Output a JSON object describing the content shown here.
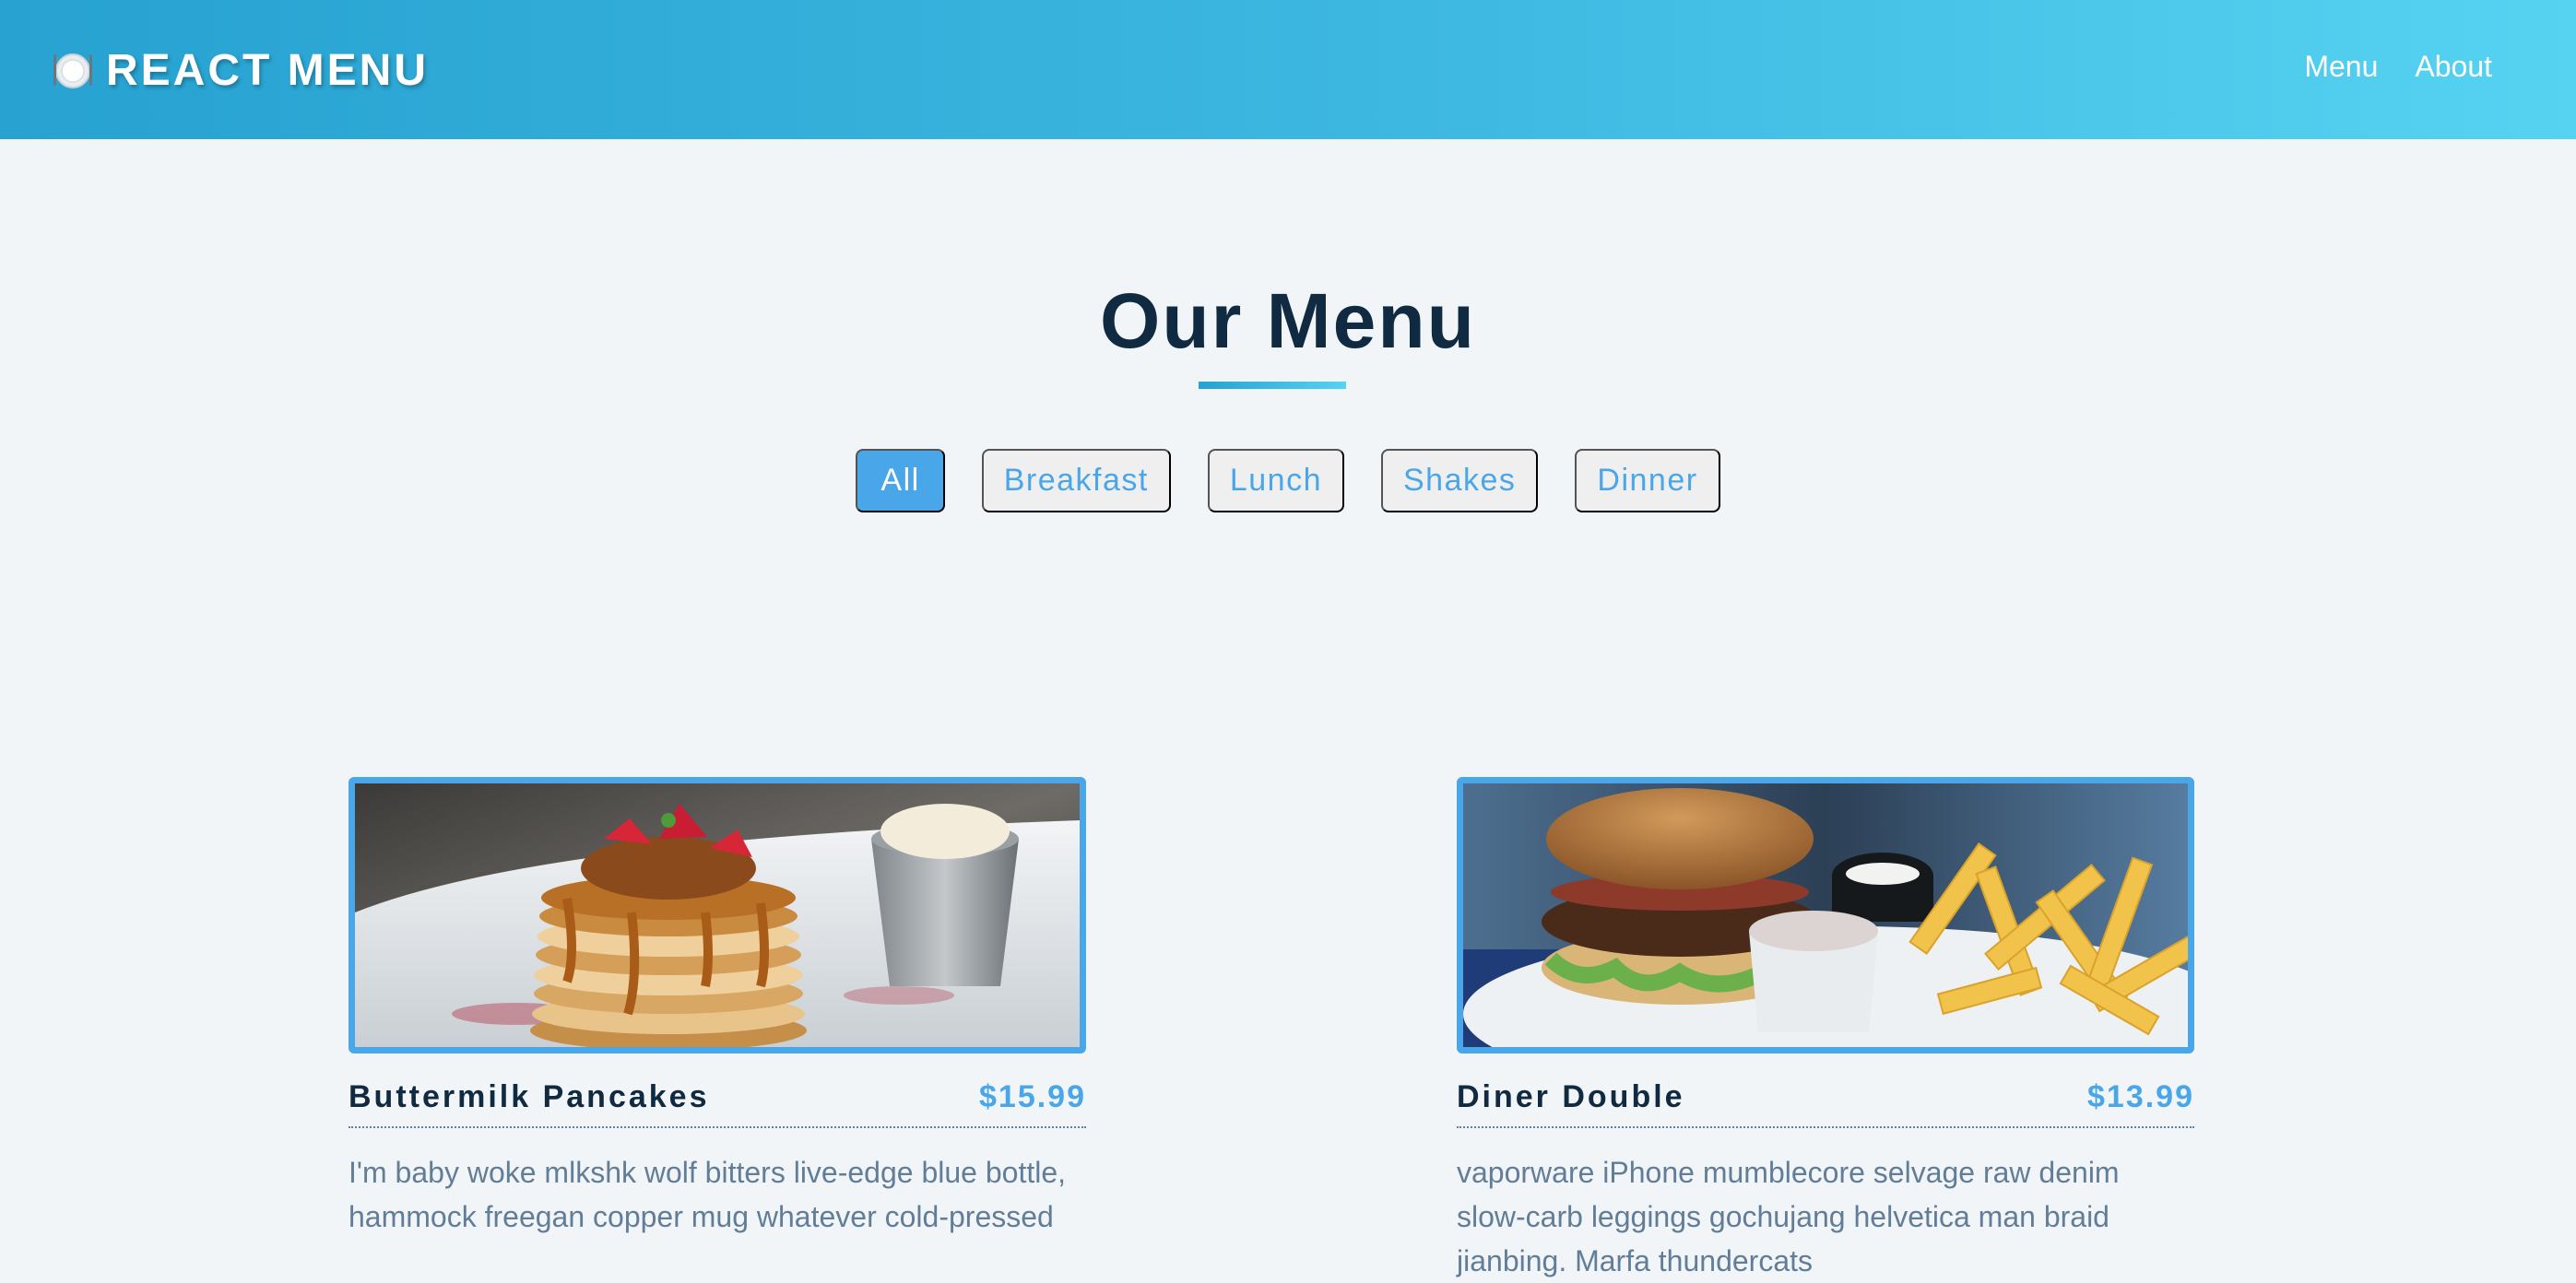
{
  "navbar": {
    "brand_icon": "plate-fork-knife-icon",
    "brand": "REACT MENU",
    "links": [
      "Menu",
      "About"
    ],
    "gradient": [
      "#27a2d1",
      "#56d3f1"
    ]
  },
  "section": {
    "title": "Our Menu",
    "accent_color": "#49a6e9"
  },
  "filters": {
    "active": "All",
    "items": [
      "All",
      "Breakfast",
      "Lunch",
      "Shakes",
      "Dinner"
    ]
  },
  "menu": [
    {
      "name": "Buttermilk Pancakes",
      "price": "$15.99",
      "image": "pancakes-photo",
      "description": "I'm baby woke mlkshk wolf bitters live-edge blue bottle, hammock freegan copper mug whatever cold-pressed"
    },
    {
      "name": "Diner Double",
      "price": "$13.99",
      "image": "burger-fries-photo",
      "description": "vaporware iPhone mumblecore selvage raw denim slow-carb leggings gochujang helvetica man braid jianbing. Marfa thundercats"
    }
  ]
}
